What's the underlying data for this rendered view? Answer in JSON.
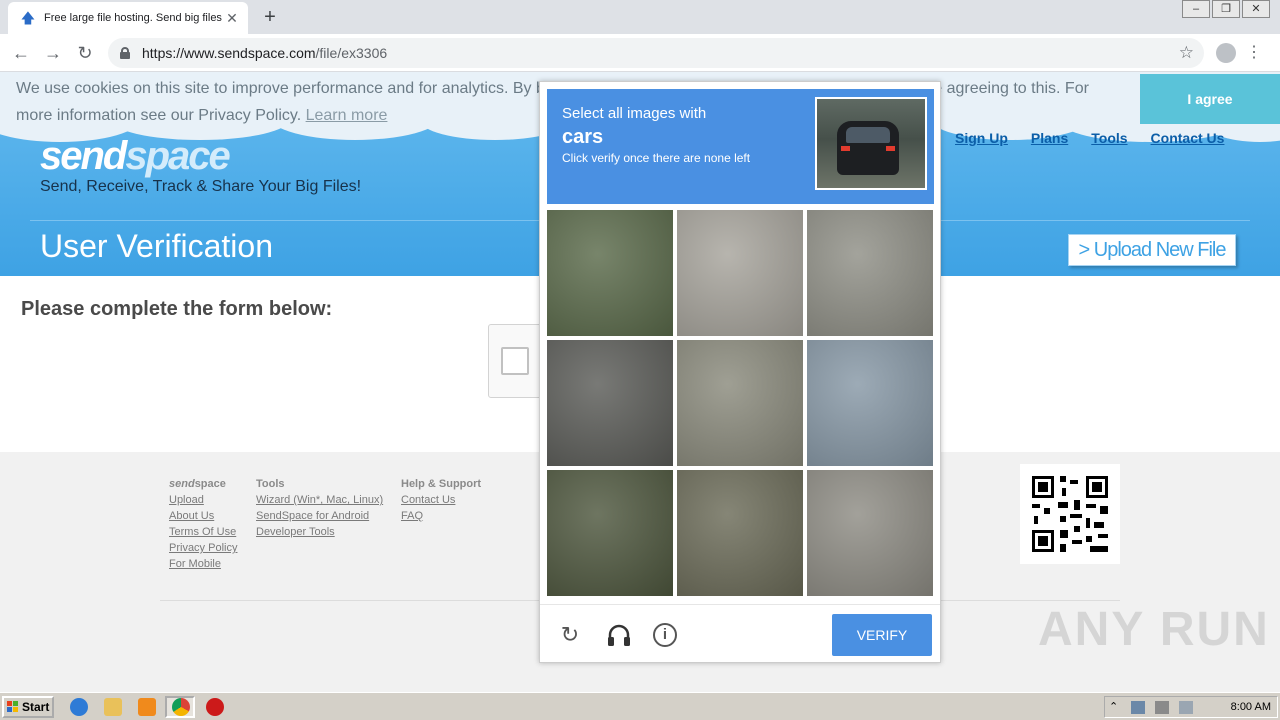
{
  "browser": {
    "tab_title": "Free large file hosting. Send big files",
    "url_host": "https://www.sendspace.com",
    "url_path": "/file/ex3306",
    "favicon_icon": "upload-arrow-icon"
  },
  "cookie_banner": {
    "text": "We use cookies on this site to improve performance and for analytics. By browsing this site, or clicking the \"I agree\" button, you are agreeing to this. For more information see our Privacy Policy.",
    "learn_more": "Learn more",
    "agree_label": "I agree"
  },
  "site": {
    "logo_part1": "send",
    "logo_part2": "space",
    "tagline": "Send, Receive, Track & Share Your Big Files!",
    "nav": [
      "Sign Up",
      "Plans",
      "Tools",
      "Contact Us"
    ],
    "page_heading": "User Verification",
    "upload_label": "> Upload New File",
    "brand_color": "#3ea2e4"
  },
  "form": {
    "title": "Please complete the form below:"
  },
  "challenge": {
    "line1": "Select all images with",
    "target": "cars",
    "line3": "Click verify once there are none left",
    "verify_label": "VERIFY",
    "accent_color": "#4a90e2",
    "tiles": [
      {
        "name": "palm-bush",
        "bg": "#5a6a4a"
      },
      {
        "name": "road-curve",
        "bg": "#a7a49c"
      },
      {
        "name": "road-intersection",
        "bg": "#8f8f86"
      },
      {
        "name": "highway-car",
        "bg": "#5b5c58"
      },
      {
        "name": "road-car-rear",
        "bg": "#8a8a7c"
      },
      {
        "name": "palm-trees-sky",
        "bg": "#8798a6"
      },
      {
        "name": "trees-shrubs",
        "bg": "#4e573e"
      },
      {
        "name": "grass-grate",
        "bg": "#6b6b58"
      },
      {
        "name": "road-car-distant",
        "bg": "#8e8c84"
      }
    ]
  },
  "footer": {
    "col1_head_bold": "send",
    "col1_head_rest": "space",
    "col1_links": [
      "Upload",
      "About Us",
      "Terms Of Use",
      "Privacy Policy",
      "For Mobile"
    ],
    "col2_head": "Tools",
    "col2_links": [
      "Wizard (Win*, Mac, Linux)",
      "SendSpace for Android",
      "Developer Tools"
    ],
    "col3_head": "Help & Support",
    "col3_links": [
      "Contact Us",
      "FAQ"
    ]
  },
  "watermark": "ANY RUN",
  "taskbar": {
    "start_label": "Start",
    "clock": "8:00 AM"
  }
}
